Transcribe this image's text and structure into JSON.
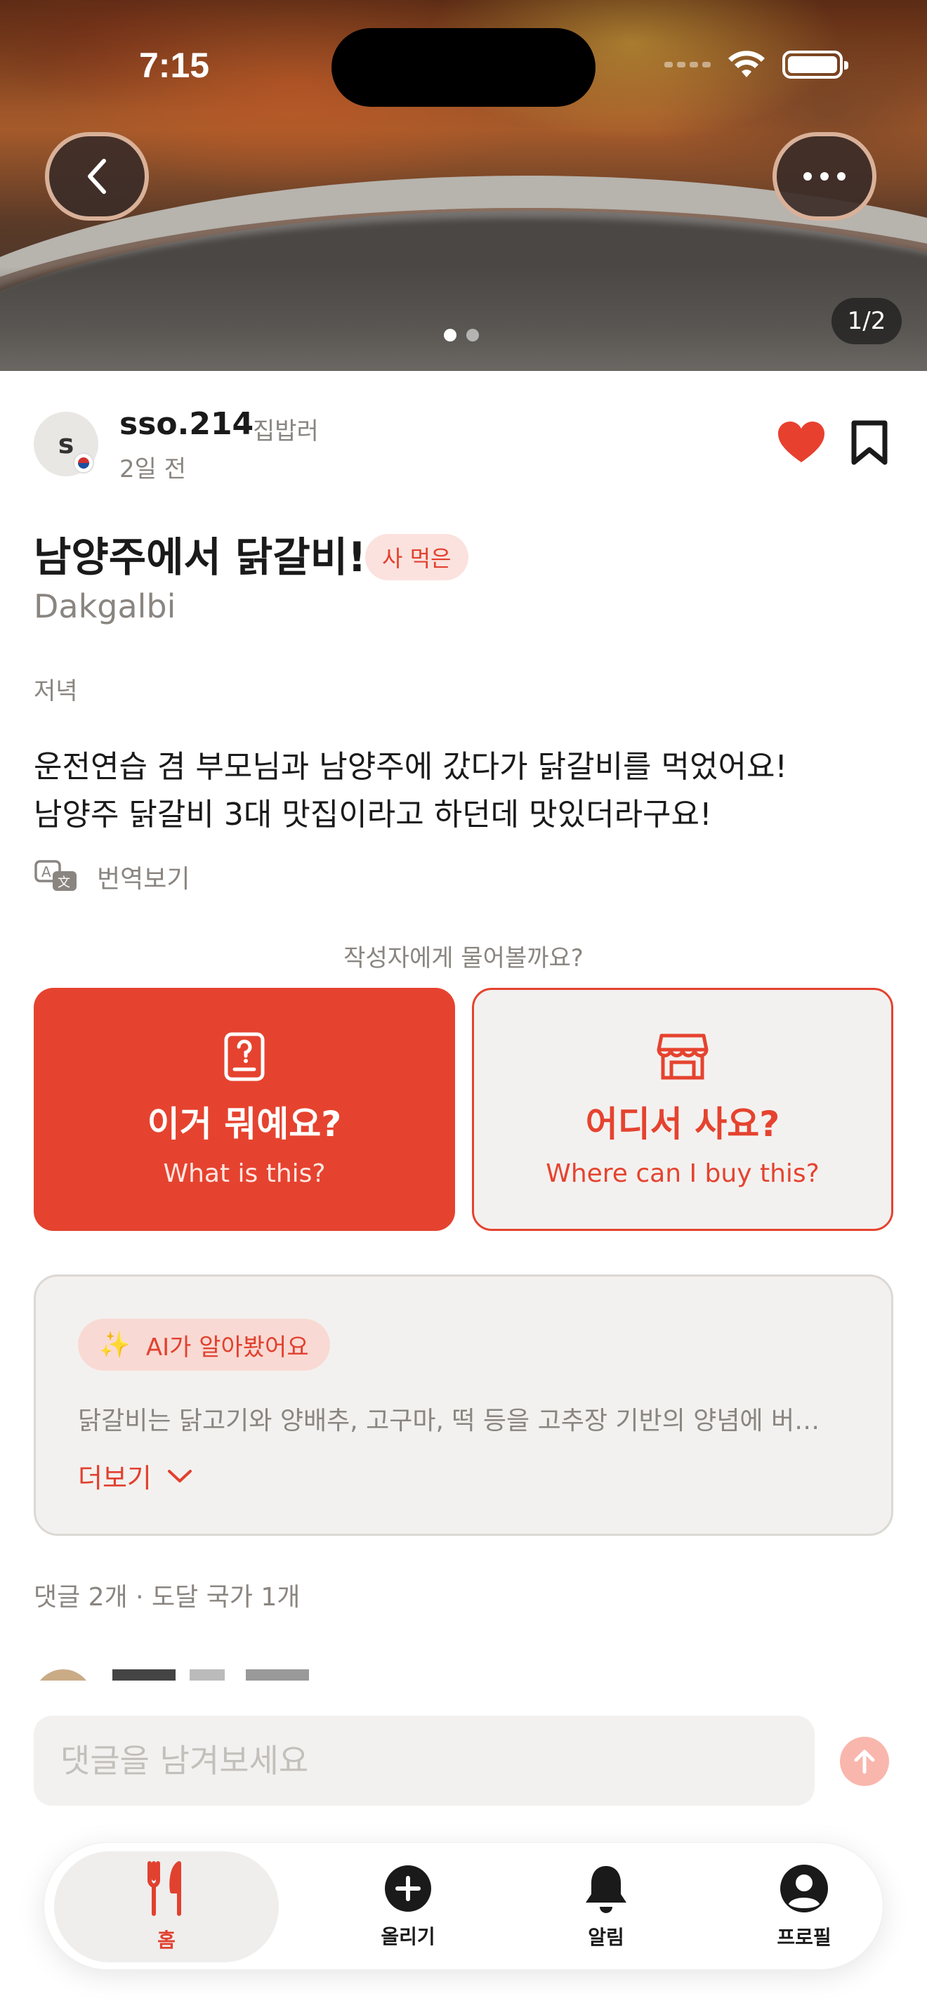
{
  "status_bar": {
    "time": "7:15"
  },
  "photo": {
    "counter": "1/2",
    "page_count": 2,
    "current_page": 1
  },
  "author": {
    "initial": "s",
    "name": "sso.214",
    "role": "집밥러",
    "posted": "2일 전",
    "liked": true,
    "bookmarked": false
  },
  "post": {
    "title": "남양주에서 닭갈비!",
    "tag": "사 먹은",
    "subtitle": "Dakgalbi",
    "meal": "저녁",
    "body_line1": "운전연습 겸 부모님과 남양주에 갔다가 닭갈비를 먹었어요!",
    "body_line2": "남양주 닭갈비 3대 맛집이라고 하던데 맛있더라구요!",
    "translate_label": "번역보기"
  },
  "ask": {
    "caption": "작성자에게 물어볼까요?",
    "what_title": "이거 뭐예요?",
    "what_sub": "What is this?",
    "where_title": "어디서 사요?",
    "where_sub": "Where can I buy this?"
  },
  "ai": {
    "chip_label": "AI가 알아봤어요",
    "text": "닭갈비는 닭고기와 양배추, 고구마, 떡 등을 고추장 기반의 양념에 버…",
    "more_label": "더보기"
  },
  "comments": {
    "stats": "댓글 2개 · 도달 국가 1개",
    "input_placeholder": "댓글을 남겨보세요"
  },
  "tabbar": {
    "home": "홈",
    "upload": "올리기",
    "alerts": "알림",
    "profile": "프로필"
  },
  "colors": {
    "accent": "#e5432f",
    "accent_soft": "#fbe2de",
    "muted_text": "#8a8580",
    "card_bg": "#f3f1ef",
    "heart": "#e8402f"
  }
}
